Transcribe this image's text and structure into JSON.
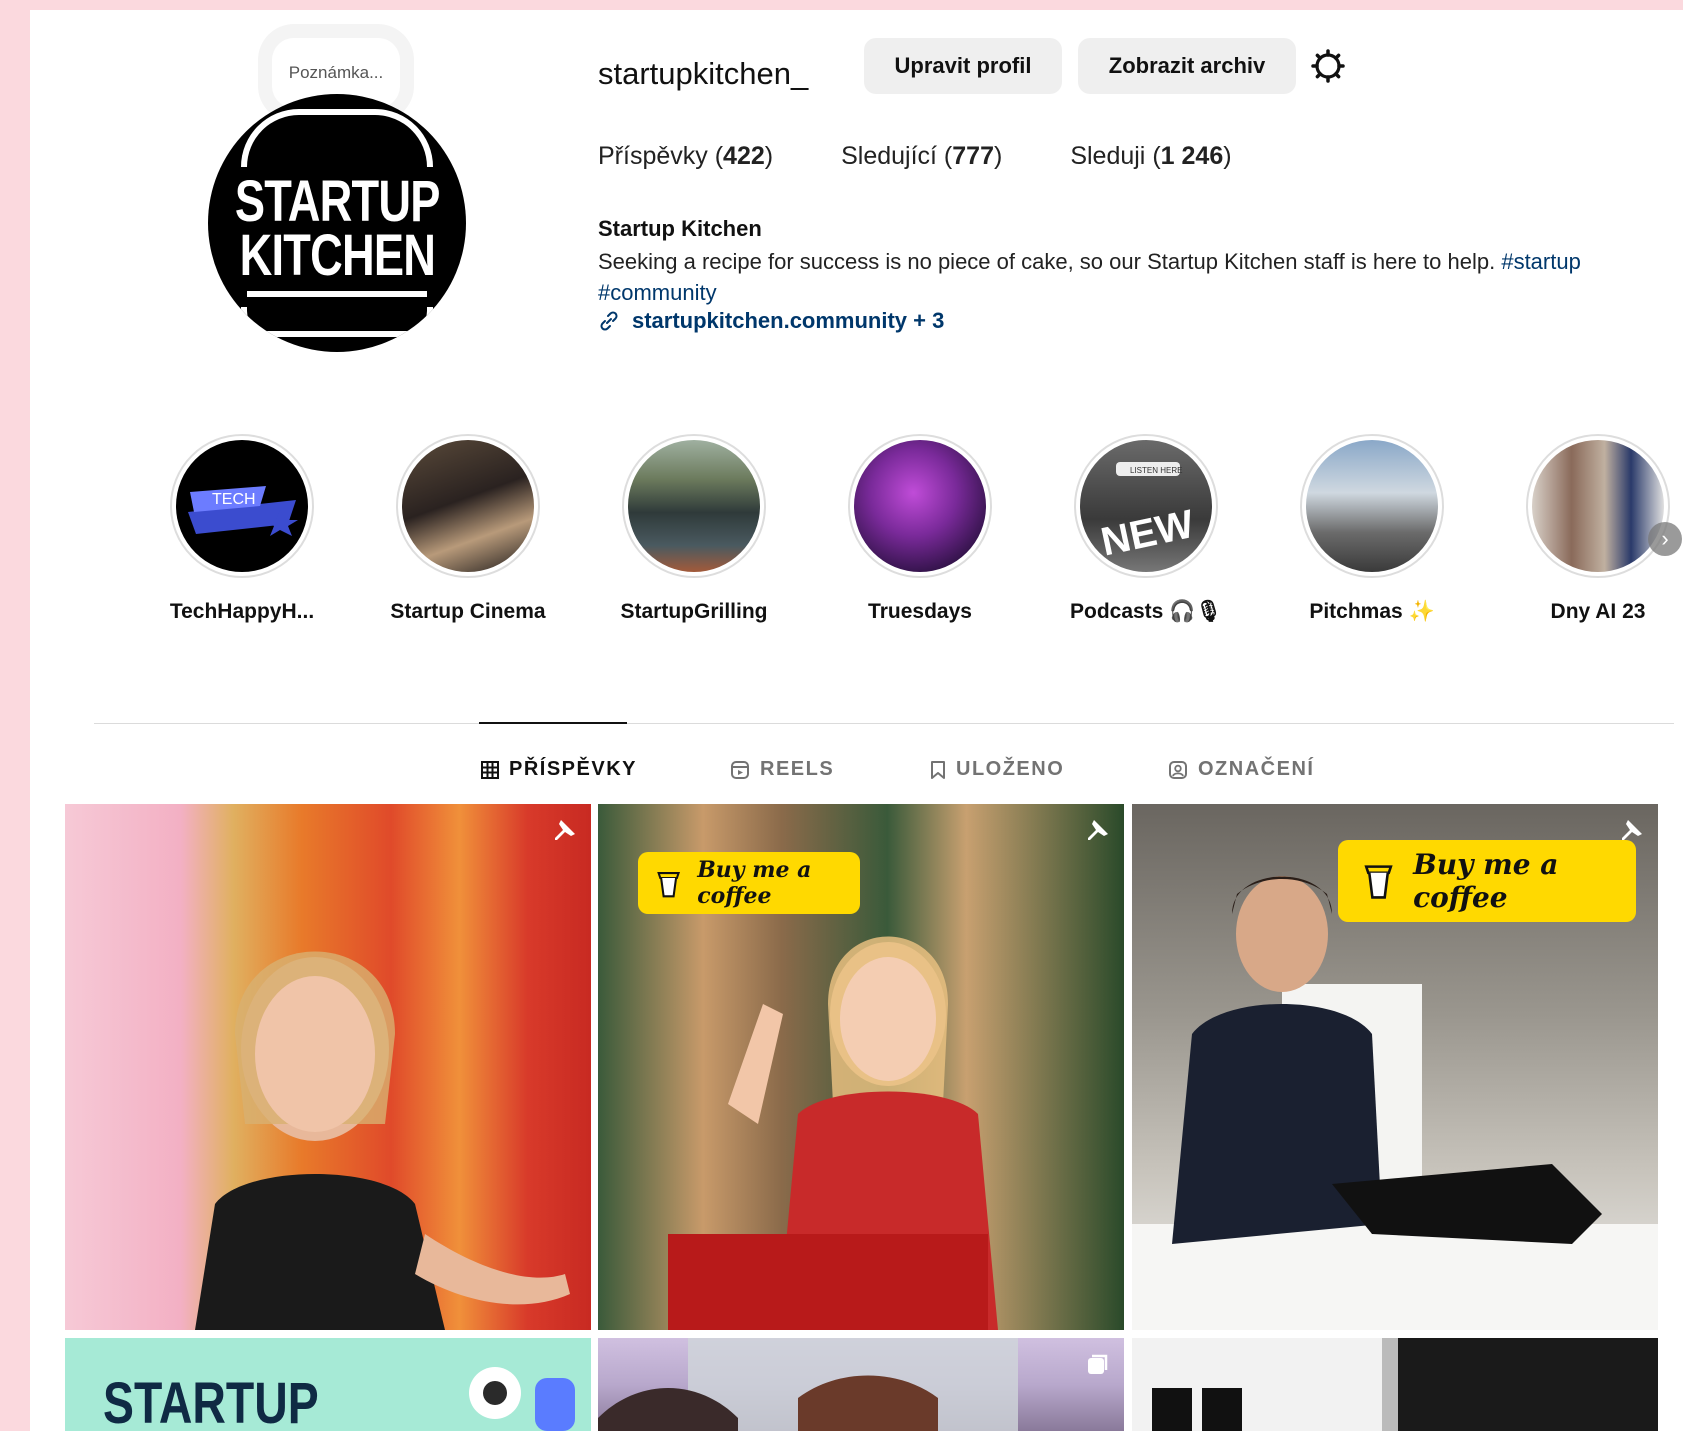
{
  "profile": {
    "note_placeholder": "Poznámka...",
    "avatar_text": [
      "STARTUP",
      "KITCHEN"
    ],
    "username": "startupkitchen_",
    "edit_button": "Upravit profil",
    "archive_button": "Zobrazit archiv",
    "stats": [
      {
        "label": "Příspěvky",
        "count": "422"
      },
      {
        "label": "Sledující",
        "count": "777"
      },
      {
        "label": "Sleduji",
        "count": "1 246"
      }
    ],
    "full_name": "Startup Kitchen",
    "bio": "Seeking a recipe for success is no piece of cake, so our Startup Kitchen staff is here to help.",
    "hashtags": [
      "#startup",
      "#community"
    ],
    "link": "startupkitchen.community",
    "link_more": "+ 3"
  },
  "highlights": [
    {
      "label": "TechHappyH..."
    },
    {
      "label": "Startup Cinema"
    },
    {
      "label": "StartupGrilling"
    },
    {
      "label": "Truesdays"
    },
    {
      "label": "Podcasts 🎧🎙"
    },
    {
      "label": "Pitchmas ✨"
    },
    {
      "label": "Dny AI 23"
    }
  ],
  "highlight_thumb_text": {
    "tech": "TECH",
    "new": "NEW",
    "listen": "LISTEN HERE"
  },
  "tabs": [
    {
      "label": "PŘÍSPĚVKY",
      "icon": "grid-icon",
      "active": true
    },
    {
      "label": "REELS",
      "icon": "reels-icon",
      "active": false
    },
    {
      "label": "ULOŽENO",
      "icon": "bookmark-icon",
      "active": false
    },
    {
      "label": "OZNAČENÍ",
      "icon": "tagged-icon",
      "active": false
    }
  ],
  "posts": {
    "coffee_label": "Buy me a coffee",
    "startup_label": "STARTUP"
  },
  "colors": {
    "page_background": "#fbd9de",
    "link": "#00376b",
    "coffee_badge": "#ffd900"
  }
}
